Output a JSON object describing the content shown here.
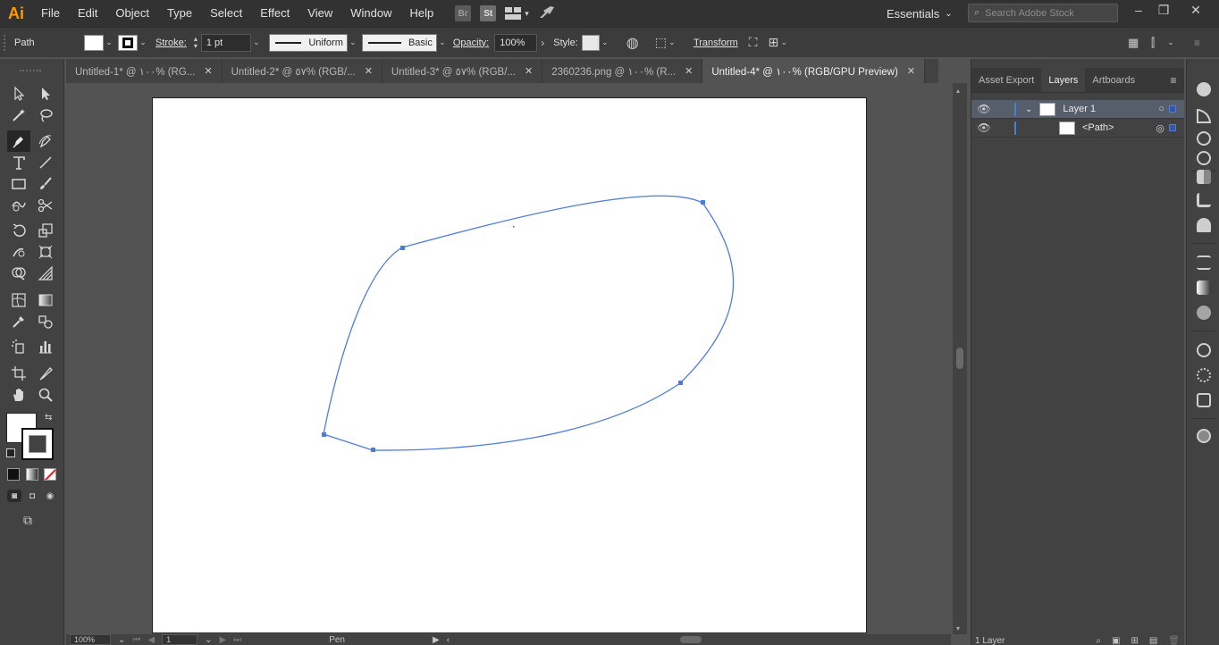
{
  "app": {
    "logo": "Ai"
  },
  "menu": [
    "File",
    "Edit",
    "Object",
    "Type",
    "Select",
    "Effect",
    "View",
    "Window",
    "Help"
  ],
  "menu_badges": {
    "bridge": "Br",
    "stock": "St"
  },
  "workspace": {
    "label": "Essentials"
  },
  "search": {
    "placeholder": "Search Adobe Stock"
  },
  "control": {
    "selection_type": "Path",
    "stroke_label": "Stroke:",
    "stroke_weight": "1 pt",
    "profile": "Uniform",
    "brush": "Basic",
    "opacity_label": "Opacity:",
    "opacity_value": "100%",
    "style_label": "Style:",
    "transform_label": "Transform"
  },
  "tabs": [
    {
      "label": "Untitled-1* @ ١٠٠% (RG...",
      "active": false
    },
    {
      "label": "Untitled-2* @ ٥٧% (RGB/...",
      "active": false
    },
    {
      "label": "Untitled-3* @ ٥٧% (RGB/...",
      "active": false
    },
    {
      "label": "2360236.png @ ١٠٠% (R...",
      "active": false
    },
    {
      "label": "Untitled-4* @ ١٠٠% (RGB/GPU Preview)",
      "active": true
    }
  ],
  "layers_panel": {
    "tabs": [
      "Asset Export",
      "Layers",
      "Artboards"
    ],
    "active_tab": "Layers",
    "rows": [
      {
        "name": "Layer 1",
        "selected": true,
        "expanded": true
      },
      {
        "name": "<Path>",
        "selected": false
      }
    ],
    "footer": "1 Layer"
  },
  "status": {
    "zoom": "100%",
    "artboard": "1",
    "tool": "Pen"
  },
  "colors": {
    "path_stroke": "#4f7dd6",
    "selection_blue": "#4f7dd6",
    "active_tool_bg": "#262626"
  }
}
